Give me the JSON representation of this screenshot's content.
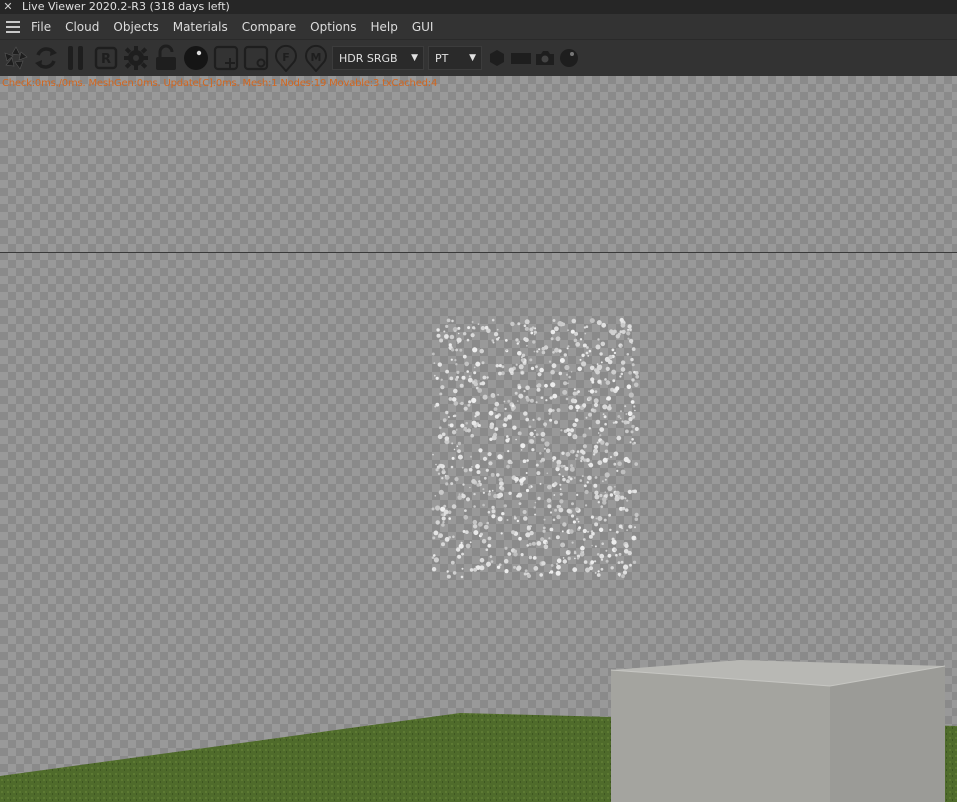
{
  "window": {
    "title": "Live Viewer 2020.2-R3 (318 days left)",
    "close_glyph": "✕"
  },
  "menu": {
    "items": [
      {
        "id": "file",
        "label": "File"
      },
      {
        "id": "cloud",
        "label": "Cloud"
      },
      {
        "id": "objects",
        "label": "Objects"
      },
      {
        "id": "materials",
        "label": "Materials"
      },
      {
        "id": "compare",
        "label": "Compare"
      },
      {
        "id": "options",
        "label": "Options"
      },
      {
        "id": "help",
        "label": "Help"
      },
      {
        "id": "gui",
        "label": "GUI"
      }
    ]
  },
  "toolbar": {
    "icons": [
      "aperture-icon",
      "refresh-icon",
      "pause-icon",
      "render-region-icon",
      "settings-gear-icon",
      "lock-icon",
      "material-ball-icon",
      "add-node-icon",
      "object-icon",
      "focus-pin-icon",
      "material-pin-icon"
    ],
    "colorspace": {
      "value": "HDR SRGB"
    },
    "kernel": {
      "value": "PT"
    },
    "right_icons": [
      "hexagon-icon",
      "rectangle-icon",
      "camera-icon",
      "sphere-icon"
    ]
  },
  "status": {
    "text": "Check:0ms./0ms. MeshGen:0ms. Update[C]:0ms. Mesh:1 Nodes:19 Movable:3 txCached:4"
  },
  "colors": {
    "status_text": "#d2661f",
    "grass": "#4e6a2a",
    "box": "#a4a49f"
  }
}
